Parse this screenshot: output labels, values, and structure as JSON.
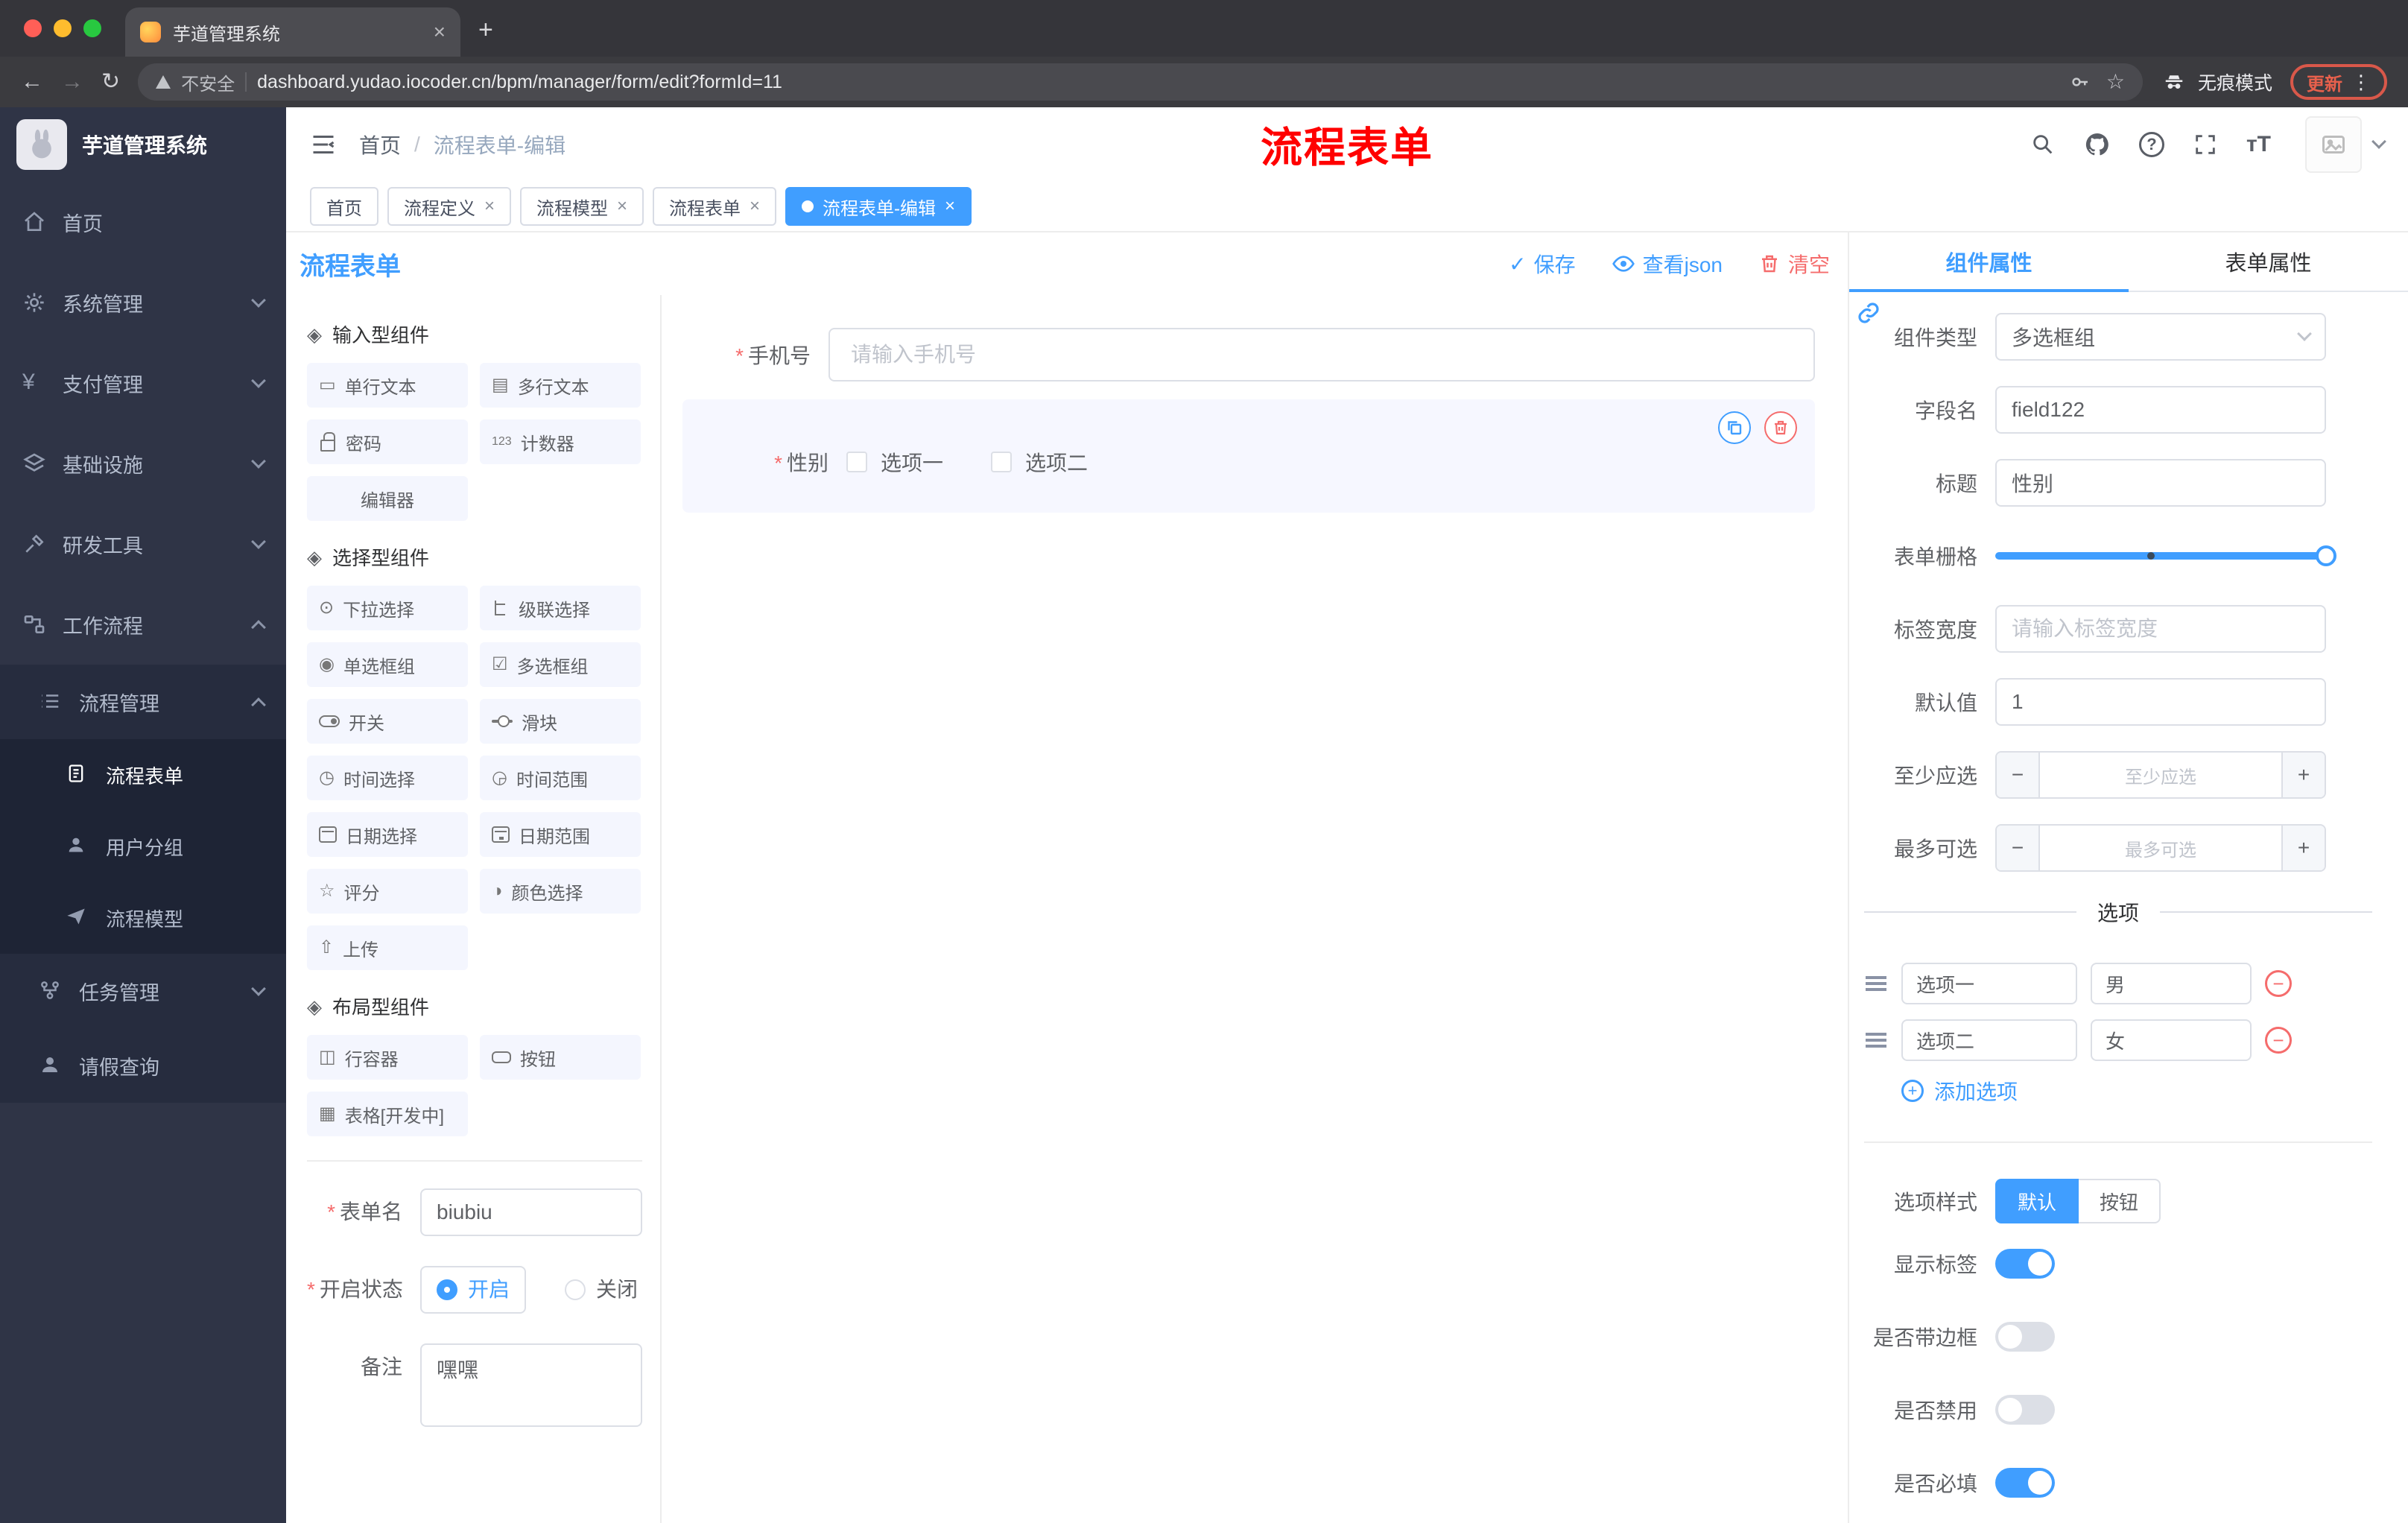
{
  "browser": {
    "tab_title": "芋道管理系统",
    "security_label": "不安全",
    "url": "dashboard.yudao.iocoder.cn/bpm/manager/form/edit?formId=11",
    "incognito_label": "无痕模式",
    "update_label": "更新"
  },
  "annotation": {
    "text": "流程表单"
  },
  "sidebar": {
    "title": "芋道管理系统",
    "menu": [
      {
        "label": "首页"
      },
      {
        "label": "系统管理"
      },
      {
        "label": "支付管理"
      },
      {
        "label": "基础设施"
      },
      {
        "label": "研发工具"
      },
      {
        "label": "工作流程"
      },
      {
        "label": "流程管理"
      },
      {
        "label": "流程表单"
      },
      {
        "label": "用户分组"
      },
      {
        "label": "流程模型"
      },
      {
        "label": "任务管理"
      },
      {
        "label": "请假查询"
      }
    ]
  },
  "header": {
    "breadcrumb_home": "首页",
    "breadcrumb_current": "流程表单-编辑"
  },
  "tags": [
    {
      "label": "首页"
    },
    {
      "label": "流程定义"
    },
    {
      "label": "流程模型"
    },
    {
      "label": "流程表单"
    },
    {
      "label": "流程表单-编辑"
    }
  ],
  "designer": {
    "title": "流程表单",
    "save_label": "保存",
    "view_json_label": "查看json",
    "clear_label": "清空",
    "palette": {
      "sections": [
        {
          "title": "输入型组件",
          "items": [
            "单行文本",
            "多行文本",
            "密码",
            "计数器",
            "编辑器"
          ]
        },
        {
          "title": "选择型组件",
          "items": [
            "下拉选择",
            "级联选择",
            "单选框组",
            "多选框组",
            "开关",
            "滑块",
            "时间选择",
            "时间范围",
            "日期选择",
            "日期范围",
            "评分",
            "颜色选择",
            "上传"
          ]
        },
        {
          "title": "布局型组件",
          "items": [
            "行容器",
            "按钮",
            "表格[开发中]"
          ]
        }
      ]
    },
    "form_meta": {
      "name_label": "表单名",
      "name_value": "biubiu",
      "status_label": "开启状态",
      "status_on": "开启",
      "status_off": "关闭",
      "remark_label": "备注",
      "remark_value": "嘿嘿"
    },
    "canvas": {
      "phone_label": "手机号",
      "phone_placeholder": "请输入手机号",
      "gender_label": "性别",
      "gender_option1": "选项一",
      "gender_option2": "选项二"
    }
  },
  "props": {
    "tab_component": "组件属性",
    "tab_form": "表单属性",
    "type_label": "组件类型",
    "type_value": "多选框组",
    "field_label": "字段名",
    "field_value": "field122",
    "title_label": "标题",
    "title_value": "性别",
    "grid_label": "表单栅格",
    "width_label": "标签宽度",
    "width_placeholder": "请输入标签宽度",
    "default_label": "默认值",
    "default_value": "1",
    "min_label": "至少应选",
    "min_placeholder": "至少应选",
    "max_label": "最多可选",
    "max_placeholder": "最多可选",
    "options_divider": "选项",
    "options": [
      {
        "label": "选项一",
        "value": "男"
      },
      {
        "label": "选项二",
        "value": "女"
      }
    ],
    "add_option_label": "添加选项",
    "style_label": "选项样式",
    "style_default": "默认",
    "style_button": "按钮",
    "switch_show_label": "显示标签",
    "switch_border": "是否带边框",
    "switch_disabled": "是否禁用",
    "switch_required": "是否必填"
  },
  "colors": {
    "primary": "#409eff",
    "danger": "#f56c6c",
    "sidebar_bg": "#2f3446",
    "annotation": "#ff0000"
  }
}
